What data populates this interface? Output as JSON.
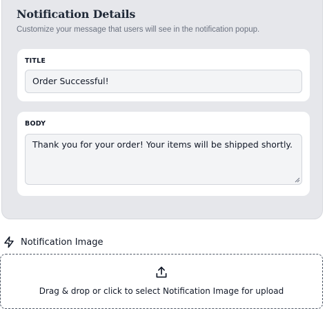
{
  "details": {
    "title": "Notification Details",
    "subtitle": "Customize your message that users will see in the notification popup."
  },
  "title_field": {
    "label": "TITLE",
    "value": "Order Successful!"
  },
  "body_field": {
    "label": "BODY",
    "value": "Thank you for your order! Your items will be shipped shortly."
  },
  "image_section": {
    "title": "Notification Image",
    "icon": "lightning-icon",
    "upload_icon": "upload-icon",
    "drop_text": "Drag & drop or click to select Notification Image for upload"
  }
}
